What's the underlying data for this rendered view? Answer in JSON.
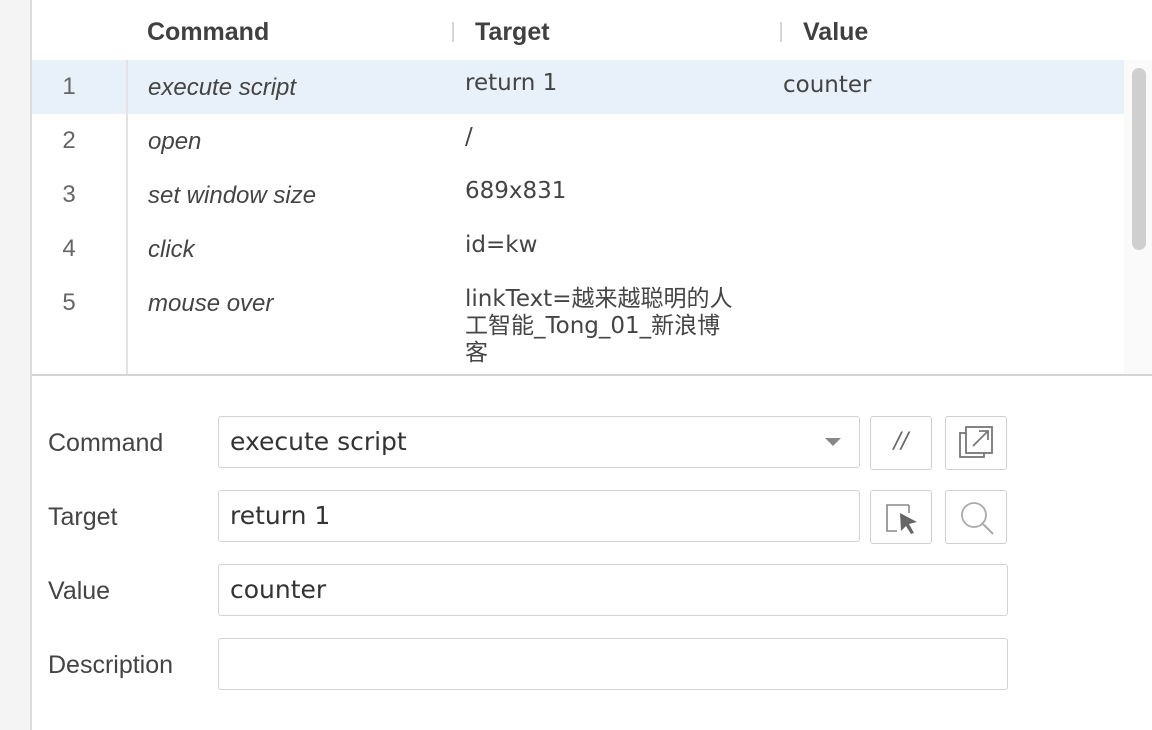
{
  "table": {
    "headers": {
      "command": "Command",
      "target": "Target",
      "value": "Value"
    },
    "rows": [
      {
        "num": "1",
        "command": "execute script",
        "target": "return 1",
        "value": "counter",
        "selected": true
      },
      {
        "num": "2",
        "command": "open",
        "target": "/",
        "value": ""
      },
      {
        "num": "3",
        "command": "set window size",
        "target": "689x831",
        "value": ""
      },
      {
        "num": "4",
        "command": "click",
        "target": "id=kw",
        "value": ""
      },
      {
        "num": "5",
        "command": "mouse over",
        "target_lines": [
          "linkText=越来越聪明的人",
          "工智能_Tong_01_新浪博",
          "客"
        ],
        "value": ""
      }
    ]
  },
  "editor": {
    "command_label": "Command",
    "command_value": "execute script",
    "comment_button": "//",
    "target_label": "Target",
    "target_value": "return 1",
    "value_label": "Value",
    "value_value": "counter",
    "description_label": "Description",
    "description_value": ""
  },
  "icons": {
    "dropdown": "chevron-down-icon",
    "open_reference": "external-link-icon",
    "select_target": "select-target-icon",
    "find_target": "search-icon"
  },
  "colors": {
    "selected_row": "#e8f0f9",
    "header_underline": "#8fc3ee"
  }
}
